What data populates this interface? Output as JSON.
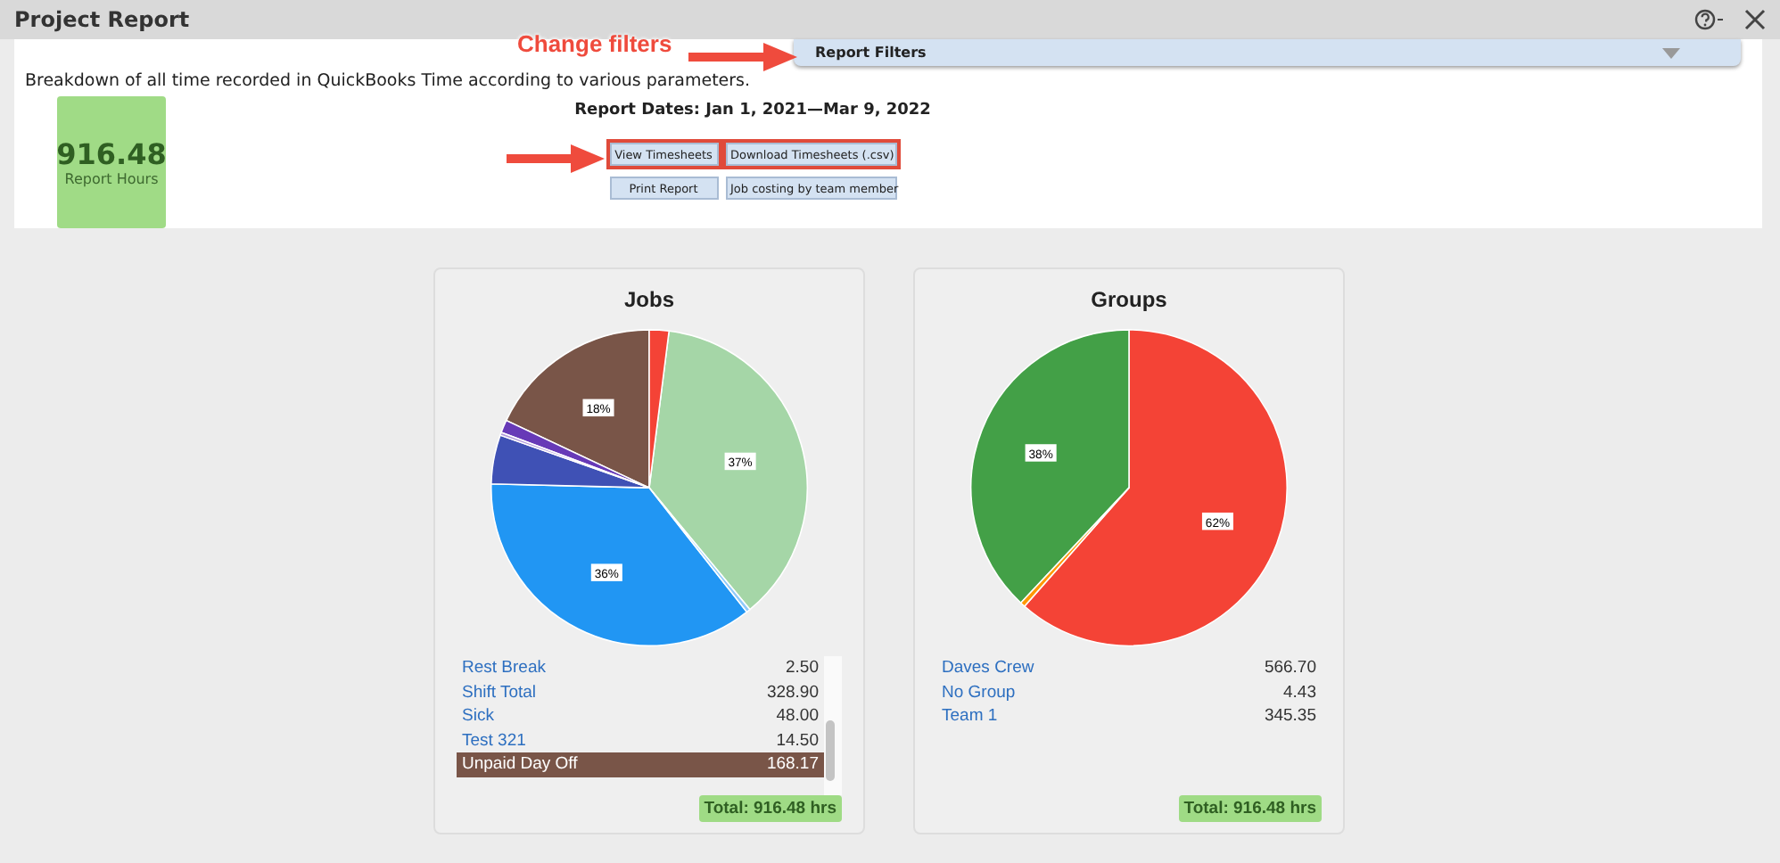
{
  "window": {
    "title": "Project Report"
  },
  "filters": {
    "label": "Report Filters",
    "expanded": false
  },
  "annotation": {
    "text": "Change filters"
  },
  "description": "Breakdown of all time recorded in QuickBooks Time according to various parameters.",
  "summary": {
    "value": "916.48",
    "label": "Report Hours"
  },
  "report_dates": "Report Dates: Jan 1, 2021—Mar 9, 2022",
  "buttons": [
    {
      "label": "View Timesheets",
      "highlighted": true
    },
    {
      "label": "Download Timesheets (.csv)",
      "highlighted": true
    },
    {
      "label": "Print Report",
      "highlighted": false
    },
    {
      "label": "Job costing by team member",
      "highlighted": false
    }
  ],
  "cards": [
    {
      "title": "Jobs",
      "chart_data": {
        "type": "pie",
        "values": [
          2,
          37,
          0.4,
          36,
          5,
          0.3,
          1.3,
          18
        ],
        "colors": [
          "#f44336",
          "#a5d6a7",
          "#90caf9",
          "#2196f3",
          "#3f51b5",
          "#b39ddb",
          "#673ab7",
          "#795548"
        ],
        "value_labels": [
          null,
          "37%",
          null,
          "36%",
          null,
          null,
          null,
          "18%"
        ]
      },
      "rows": [
        {
          "name": "Rest Break",
          "value": "2.50",
          "selected": false
        },
        {
          "name": "Shift Total",
          "value": "328.90",
          "selected": false
        },
        {
          "name": "Sick",
          "value": "48.00",
          "selected": false
        },
        {
          "name": "Test 321",
          "value": "14.50",
          "selected": false
        },
        {
          "name": "Unpaid Day Off",
          "value": "168.17",
          "selected": true,
          "color": "#795548"
        }
      ],
      "scrollable": true,
      "total": "Total: 916.48 hrs"
    },
    {
      "title": "Groups",
      "chart_data": {
        "type": "pie",
        "values": [
          61.5,
          0.5,
          38
        ],
        "colors": [
          "#f44336",
          "#ff9800",
          "#43a047"
        ],
        "value_labels": [
          "62%",
          null,
          "38%"
        ]
      },
      "rows": [
        {
          "name": "Daves Crew",
          "value": "566.70",
          "selected": false
        },
        {
          "name": "No Group",
          "value": "4.43",
          "selected": false
        },
        {
          "name": "Team 1",
          "value": "345.35",
          "selected": false
        }
      ],
      "scrollable": false,
      "total": "Total: 916.48 hrs"
    }
  ]
}
